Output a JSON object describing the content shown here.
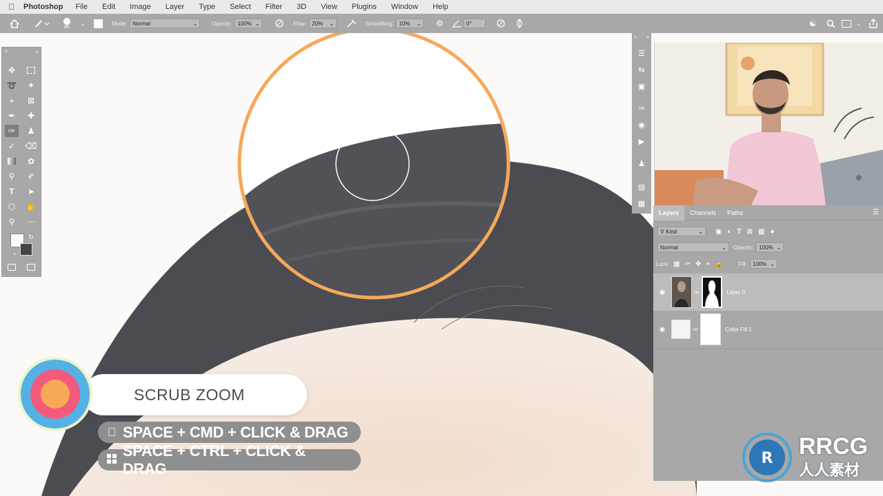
{
  "menubar": {
    "app": "Photoshop",
    "items": [
      "File",
      "Edit",
      "Image",
      "Layer",
      "Type",
      "Select",
      "Filter",
      "3D",
      "View",
      "Plugins",
      "Window",
      "Help"
    ]
  },
  "options": {
    "brush_size": "86",
    "mode_label": "Mode:",
    "mode_value": "Normal",
    "opacity_label": "Opacity:",
    "opacity_value": "100%",
    "flow_label": "Flow:",
    "flow_value": "20%",
    "smoothing_label": "Smoothing:",
    "smoothing_value": "10%",
    "angle_value": "0°"
  },
  "layers_panel": {
    "tabs": [
      "Layers",
      "Channels",
      "Paths"
    ],
    "filter_kind": "Kind",
    "blend_mode": "Normal",
    "opacity_label": "Opacity:",
    "opacity_value": "100%",
    "lock_label": "Lock:",
    "fill_label": "Fill:",
    "fill_value": "100%",
    "layers": [
      {
        "name": "Layer 0",
        "selected": true
      },
      {
        "name": "Color Fill 1",
        "selected": false
      }
    ]
  },
  "overlay": {
    "title": "SCRUB ZOOM",
    "mac_shortcut": "SPACE + CMD + CLICK & DRAG",
    "win_shortcut": "SPACE + CTRL + CLICK & DRAG"
  },
  "watermark": {
    "brand": "RRCG",
    "sub": "人人素材"
  },
  "colors": {
    "accent_ring": "#f6a85a",
    "target_outer": "#55b0e6",
    "target_mid": "#f45a7c",
    "target_inner": "#f7a955"
  }
}
